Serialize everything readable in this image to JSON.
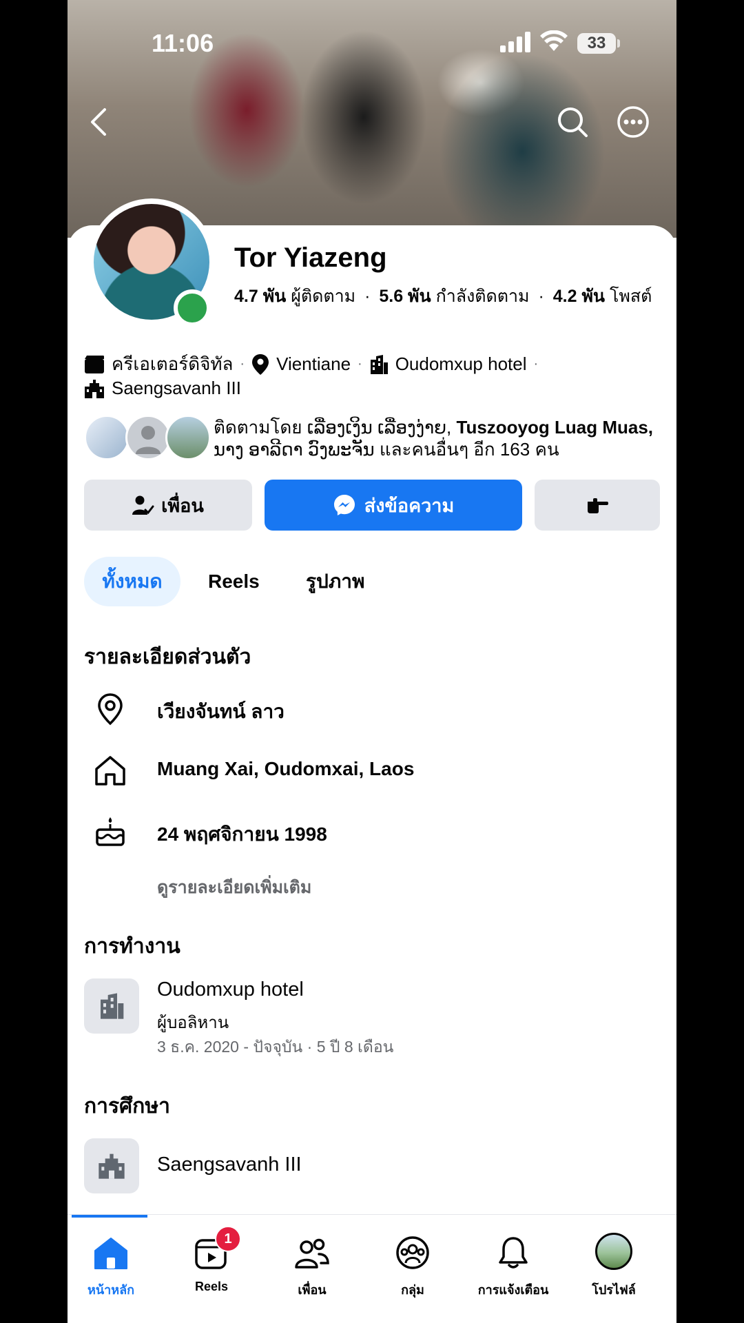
{
  "status_bar": {
    "time": "11:06",
    "battery": "33"
  },
  "profile": {
    "name": "Tor Yiazeng",
    "stats": [
      {
        "value": "4.7 พัน",
        "label": "ผู้ติดตาม"
      },
      {
        "value": "5.6 พัน",
        "label": "กำลังติดตาม"
      },
      {
        "value": "4.2 พัน",
        "label": "โพสต์"
      }
    ],
    "meta": {
      "category": "ครีเอเตอร์ดิจิทัล",
      "location": "Vientiane",
      "work": "Oudomxup hotel",
      "school": "Saengsavanh III"
    },
    "followed_by": {
      "prefix": "ติดตามโดย ",
      "names_regular": "ເລື່ອງເງິນ ເລື່ອງງ່າຍ, ",
      "names_bold": "Tuszooyog Luag Muas,",
      "line2": "ນາງ ອາລີດາ ວົງພະຈັນ และคนอื่นๆ อีก 163 คน"
    }
  },
  "actions": {
    "friends": "เพื่อน",
    "message": "ส่งข้อความ"
  },
  "tabs": [
    "ทั้งหมด",
    "Reels",
    "รูปภาพ"
  ],
  "details": {
    "title": "รายละเอียดส่วนตัว",
    "current_city": "เวียงจันทน์ ลาว",
    "hometown": "Muang Xai, Oudomxai, Laos",
    "birthday": "24 พฤศจิกายน  1998",
    "see_more": "ดูรายละเอียดเพิ่มเติม"
  },
  "work": {
    "title": "การทำงาน",
    "company": "Oudomxup hotel",
    "position": "ผู้บอลิหาน",
    "period": "3 ธ.ค. 2020 - ปัจจุบัน · 5 ปี 8 เดือน"
  },
  "education": {
    "title": "การศึกษา",
    "school": "Saengsavanh III"
  },
  "bottom_nav": {
    "home": "หน้าหลัก",
    "reels": "Reels",
    "reels_badge": "1",
    "friends": "เพื่อน",
    "groups": "กลุ่ม",
    "notifications": "การแจ้งเตือน",
    "profile": "โปรไฟล์"
  },
  "colors": {
    "accent": "#1877f2",
    "online": "#2ba24c",
    "badge": "#e41e3f",
    "button_gray": "#e4e6eb"
  }
}
